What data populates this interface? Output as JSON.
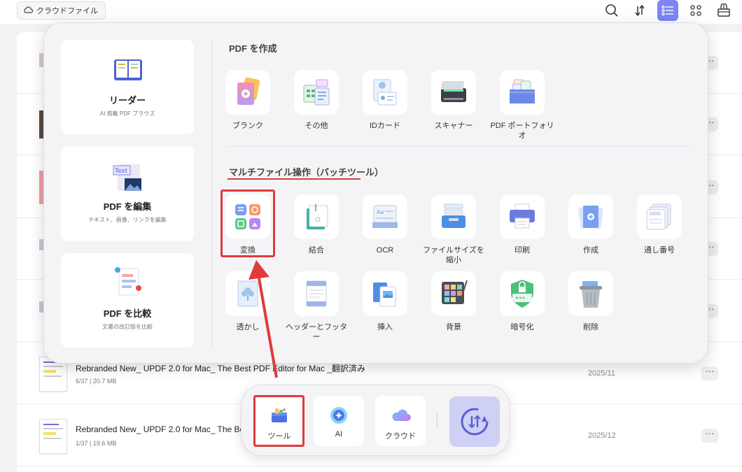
{
  "topbar": {
    "cloud_label": "クラウドファイル",
    "icons": [
      "search-icon",
      "sort-icon",
      "list-view-icon",
      "grid-view-icon",
      "basket-icon"
    ]
  },
  "file_list": {
    "files": [
      {
        "title": "Rebranded New_ UPDF 2.0 for Mac_ The Best PDF Editor for Mac _翻訳済み",
        "meta": "6/37 | 20.7 MB",
        "date": "2025/11"
      },
      {
        "title": "Rebranded New_ UPDF 2.0 for Mac_ The Best",
        "meta": "1/37 | 19.6 MB",
        "date": "2025/12"
      }
    ]
  },
  "left_cards": [
    {
      "title": "リーダー",
      "subtitle": "AI 搭載 PDF ブラウズ"
    },
    {
      "title": "PDF を編集",
      "subtitle": "テキスト、画像、リンクを編集",
      "icon_text": "Text"
    },
    {
      "title": "PDF を比較",
      "subtitle": "文書の改訂版を比較"
    }
  ],
  "create_section": {
    "title": "PDF を作成",
    "items": [
      {
        "label": "ブランク",
        "icon": "blank-doc-icon"
      },
      {
        "label": "その他",
        "icon": "other-formats-icon"
      },
      {
        "label": "IDカード",
        "icon": "id-card-icon"
      },
      {
        "label": "スキャナー",
        "icon": "scanner-icon"
      },
      {
        "label": "PDF ポートフォリオ",
        "icon": "portfolio-icon"
      }
    ]
  },
  "batch_section": {
    "title": "マルチファイル操作（バッチツール）",
    "row1": [
      {
        "label": "変換",
        "icon": "convert-icon"
      },
      {
        "label": "結合",
        "icon": "combine-icon"
      },
      {
        "label": "OCR",
        "icon": "ocr-icon"
      },
      {
        "label": "ファイルサイズを縮小",
        "icon": "compress-icon"
      },
      {
        "label": "印刷",
        "icon": "print-icon"
      },
      {
        "label": "作成",
        "icon": "create-icon"
      },
      {
        "label": "通し番号",
        "icon": "bates-number-icon"
      }
    ],
    "row2": [
      {
        "label": "透かし",
        "icon": "watermark-icon"
      },
      {
        "label": "ヘッダーとフッター",
        "icon": "header-footer-icon"
      },
      {
        "label": "挿入",
        "icon": "insert-icon"
      },
      {
        "label": "背景",
        "icon": "background-icon"
      },
      {
        "label": "暗号化",
        "icon": "encrypt-icon"
      },
      {
        "label": "削除",
        "icon": "delete-icon"
      }
    ]
  },
  "dock": {
    "items": [
      {
        "label": "ツール",
        "icon": "toolbox-icon"
      },
      {
        "label": "AI",
        "icon": "ai-icon"
      },
      {
        "label": "クラウド",
        "icon": "cloud-icon"
      }
    ],
    "action_icon": "sync-icon"
  },
  "colors": {
    "accent": "#7e83f5",
    "highlight_red": "#e03a3a",
    "popup_bg": "#f4f4f6"
  }
}
